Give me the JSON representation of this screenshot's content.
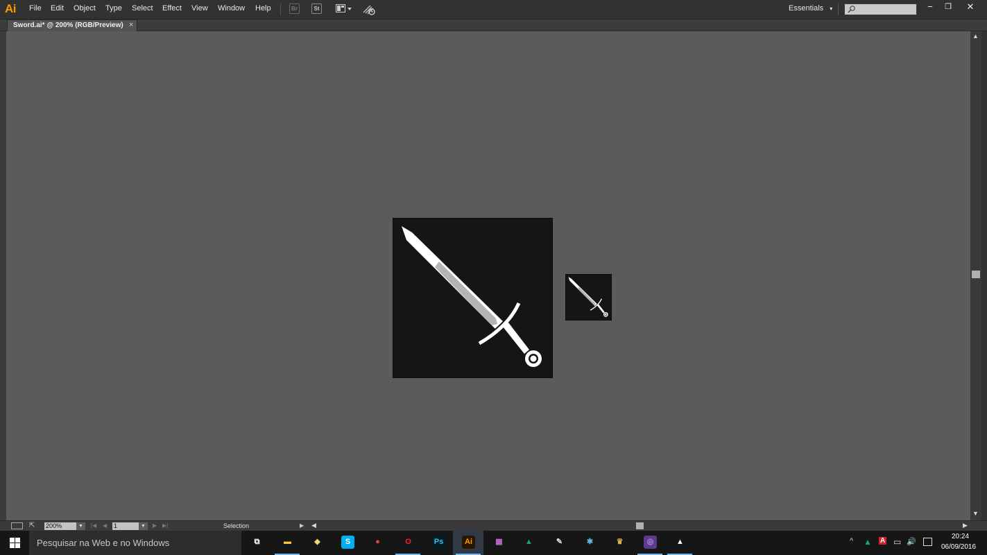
{
  "app": {
    "logo": "Ai",
    "accent": "#ff9a00"
  },
  "menu": [
    "File",
    "Edit",
    "Object",
    "Type",
    "Select",
    "Effect",
    "View",
    "Window",
    "Help"
  ],
  "toolbar": {
    "bridge_label": "Br",
    "stock_label": "St"
  },
  "workspace": {
    "label": "Essentials",
    "arrow": "▾"
  },
  "search": {
    "placeholder": ""
  },
  "window_controls": {
    "minimize": "−",
    "restore": "❐",
    "close": "✕"
  },
  "document_tab": {
    "title": "Sword.ai* @ 200% (RGB/Preview)",
    "close": "×"
  },
  "statusbar": {
    "zoom": "200%",
    "artboard": "1",
    "tool": "Selection"
  },
  "taskbar": {
    "search_placeholder": "Pesquisar na Web e no Windows",
    "apps": [
      {
        "name": "task-view",
        "glyph": "⧉",
        "color": "#ffffff",
        "bg": "transparent"
      },
      {
        "name": "file-explorer",
        "glyph": "▬",
        "color": "#f8c63d",
        "bg": "transparent"
      },
      {
        "name": "folder-sync",
        "glyph": "◆",
        "color": "#f3d36b",
        "bg": "transparent"
      },
      {
        "name": "skype",
        "glyph": "S",
        "color": "#ffffff",
        "bg": "#00aff0"
      },
      {
        "name": "chrome",
        "glyph": "●",
        "color": "#e8453c",
        "bg": "transparent"
      },
      {
        "name": "opera",
        "glyph": "O",
        "color": "#ff1b2d",
        "bg": "transparent"
      },
      {
        "name": "photoshop",
        "glyph": "Ps",
        "color": "#31c5f0",
        "bg": "#001d26"
      },
      {
        "name": "illustrator",
        "glyph": "Ai",
        "color": "#ff9a00",
        "bg": "#2a1600"
      },
      {
        "name": "game-app",
        "glyph": "▦",
        "color": "#c06cd0",
        "bg": "transparent"
      },
      {
        "name": "google-drive",
        "glyph": "▲",
        "color": "#1fa463",
        "bg": "transparent"
      },
      {
        "name": "paint-app",
        "glyph": "✎",
        "color": "#dddddd",
        "bg": "transparent"
      },
      {
        "name": "network-app",
        "glyph": "✱",
        "color": "#5fb6e8",
        "bg": "transparent"
      },
      {
        "name": "character-app",
        "glyph": "♛",
        "color": "#d8b24a",
        "bg": "transparent"
      },
      {
        "name": "tor-app",
        "glyph": "◎",
        "color": "#b58de8",
        "bg": "#5a3b8c"
      },
      {
        "name": "photos-app",
        "glyph": "▲",
        "color": "#ffffff",
        "bg": "transparent"
      }
    ],
    "active_app": "illustrator",
    "tray": {
      "chevron": "^",
      "drive": "▲",
      "acrobat": "A",
      "network": "▭",
      "volume": "🔊"
    },
    "clock": {
      "time": "20:24",
      "date": "06/09/2016"
    }
  },
  "colors": {
    "canvas": "#5b5b5b",
    "artboard": "#151515",
    "sword_blade": "#ffffff",
    "sword_fuller": "#b4b4b4"
  }
}
